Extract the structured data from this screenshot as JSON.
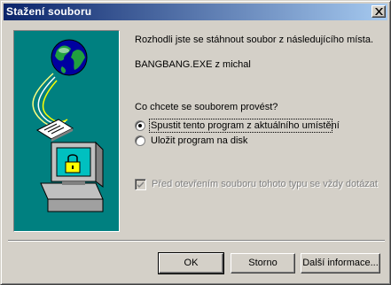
{
  "window": {
    "title": "Stažení souboru"
  },
  "message": {
    "intro": "Rozhodli jste se stáhnout soubor z následujícího místa.",
    "source": "BANGBANG.EXE z michal"
  },
  "question": "Co chcete se souborem provést?",
  "options": [
    {
      "label": "Spustit tento program z aktuálního umístění",
      "selected": true
    },
    {
      "label": "Uložit program na disk",
      "selected": false
    }
  ],
  "always_ask": {
    "label": "Před otevřením souboru tohoto typu se vždy dotázat",
    "checked": true,
    "enabled": false
  },
  "buttons": {
    "ok": "OK",
    "cancel": "Storno",
    "more_info": "Další informace..."
  },
  "colors": {
    "title_start": "#0a246a",
    "title_end": "#a6caf0",
    "art_background": "#008080",
    "face": "#d4d0c8"
  },
  "icons": [
    "close-icon",
    "globe-icon",
    "document-icon",
    "computer-icon",
    "lock-icon"
  ]
}
